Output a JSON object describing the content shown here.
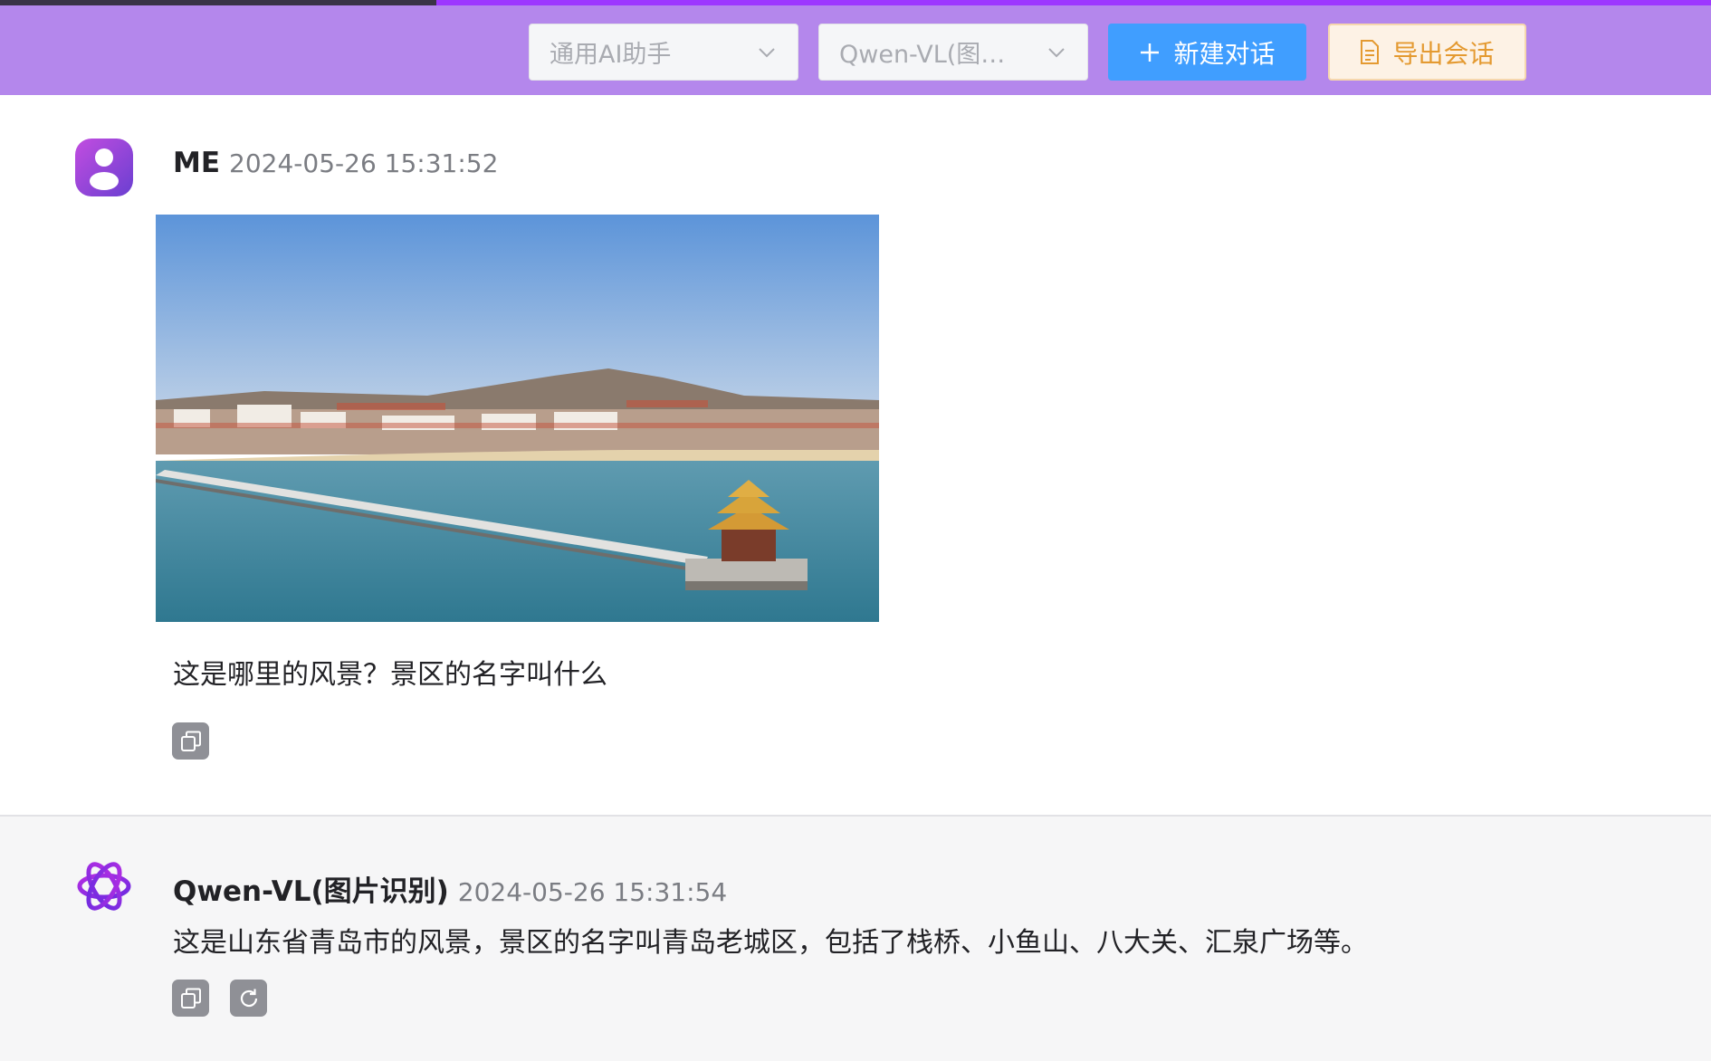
{
  "header": {
    "load_progress": 0.255,
    "assistant_select": {
      "value": "通用AI助手"
    },
    "model_select": {
      "value": "Qwen-VL(图片识别)"
    },
    "new_chat_button": {
      "label": "新建对话",
      "icon": "plus-icon"
    },
    "export_button": {
      "label": "导出会话",
      "icon": "document-icon"
    },
    "colors": {
      "bar": "#b487ec",
      "primary": "#409eff",
      "export_text": "#e49a31"
    }
  },
  "messages": [
    {
      "role": "user",
      "name": "ME",
      "time": "2024-05-26 15:31:52",
      "avatar_icon": "user-avatar-icon",
      "has_image": true,
      "image_description_icon": "uploaded-photo",
      "text": "这是哪里的风景？景区的名字叫什么",
      "actions": [
        "copy-icon"
      ]
    },
    {
      "role": "assistant",
      "name": "Qwen-VL(图片识别)",
      "time": "2024-05-26 15:31:54",
      "avatar_icon": "openai-logo-icon",
      "text": "这是山东省青岛市的风景，景区的名字叫青岛老城区，包括了栈桥、小鱼山、八大关、汇泉广场等。",
      "actions": [
        "copy-icon",
        "regenerate-icon"
      ]
    }
  ]
}
